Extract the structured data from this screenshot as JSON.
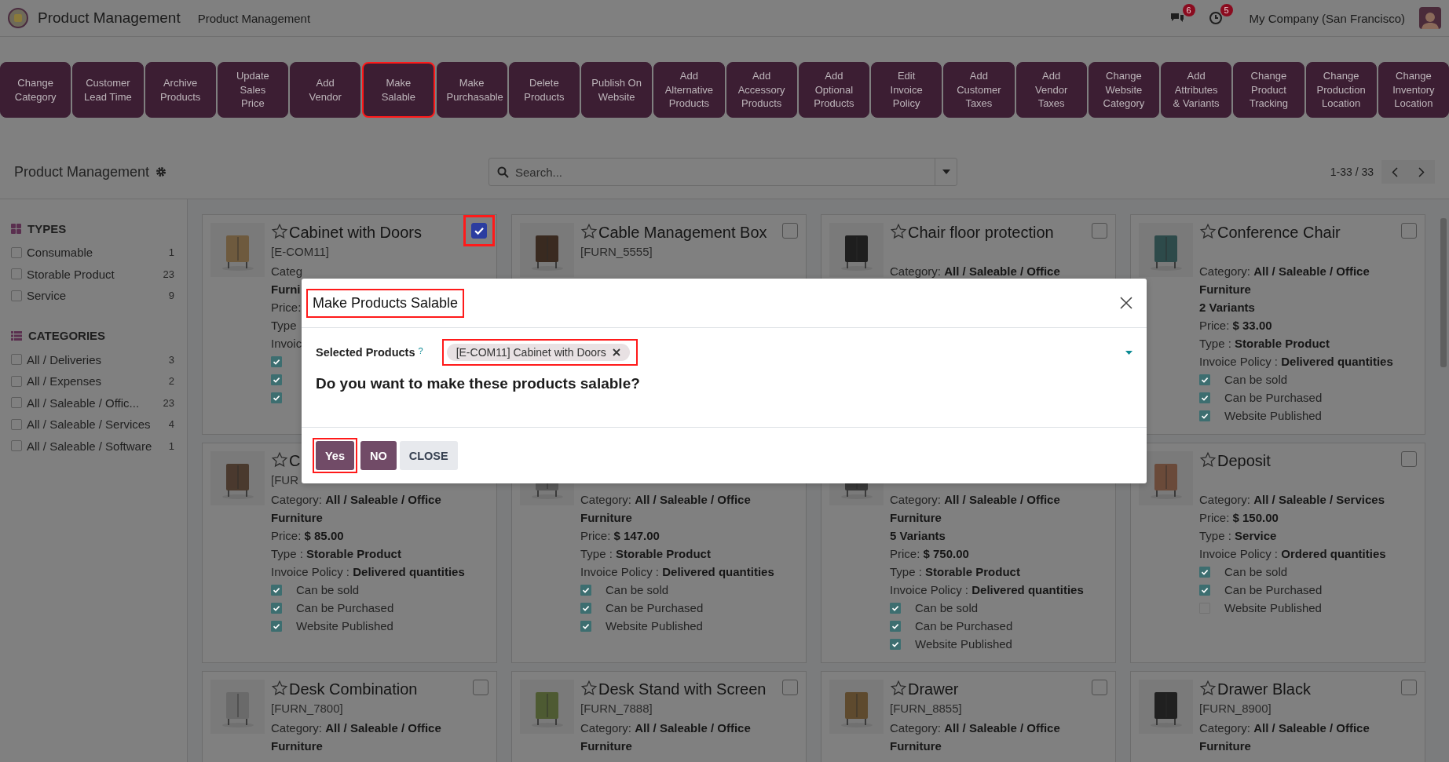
{
  "navbar": {
    "app_name": "Product Management",
    "menu_item": "Product Management",
    "messages_count": "6",
    "activities_count": "5",
    "company": "My Company (San Francisco)"
  },
  "action_buttons": [
    {
      "label": "Change Category",
      "highlighted": false
    },
    {
      "label": "Customer Lead Time",
      "highlighted": false
    },
    {
      "label": "Archive Products",
      "highlighted": false
    },
    {
      "label": "Update Sales Price",
      "highlighted": false
    },
    {
      "label": "Add Vendor",
      "highlighted": false
    },
    {
      "label": "Make Salable",
      "highlighted": true
    },
    {
      "label": "Make Purchasable",
      "highlighted": false
    },
    {
      "label": "Delete Products",
      "highlighted": false
    },
    {
      "label": "Publish On Website",
      "highlighted": false
    },
    {
      "label": "Add Alternative Products",
      "highlighted": false
    },
    {
      "label": "Add Accessory Products",
      "highlighted": false
    },
    {
      "label": "Add Optional Products",
      "highlighted": false
    },
    {
      "label": "Edit Invoice Policy",
      "highlighted": false
    },
    {
      "label": "Add Customer Taxes",
      "highlighted": false
    },
    {
      "label": "Add Vendor Taxes",
      "highlighted": false
    },
    {
      "label": "Change Website Category",
      "highlighted": false
    },
    {
      "label": "Add Attributes & Variants",
      "highlighted": false
    },
    {
      "label": "Change Product Tracking",
      "highlighted": false
    },
    {
      "label": "Change Production Location",
      "highlighted": false
    },
    {
      "label": "Change Inventory Location",
      "highlighted": false
    }
  ],
  "control_panel": {
    "title": "Product Management",
    "search_placeholder": "Search...",
    "pager": "1-33 / 33"
  },
  "sidebar": {
    "sections": [
      {
        "title": "TYPES",
        "kind": "grid",
        "items": [
          {
            "label": "Consumable",
            "count": "1",
            "checked": false
          },
          {
            "label": "Storable Product",
            "count": "23",
            "checked": false
          },
          {
            "label": "Service",
            "count": "9",
            "checked": false
          }
        ]
      },
      {
        "title": "CATEGORIES",
        "kind": "list",
        "items": [
          {
            "label": "All / Deliveries",
            "count": "3",
            "checked": false
          },
          {
            "label": "All / Expenses",
            "count": "2",
            "checked": false
          },
          {
            "label": "All / Saleable / Offic...",
            "count": "23",
            "checked": false
          },
          {
            "label": "All / Saleable / Services",
            "count": "4",
            "checked": false
          },
          {
            "label": "All / Saleable / Software",
            "count": "1",
            "checked": false
          }
        ]
      }
    ]
  },
  "cards": [
    {
      "title": "Cabinet with Doors",
      "code": "[E-COM11]",
      "selected": true,
      "highlighted": true,
      "lines": [
        {
          "label": "Categ"
        },
        {
          "value": "Furni"
        },
        {
          "label": "Price:"
        },
        {
          "label": "Type"
        },
        {
          "label": "Invoic"
        }
      ],
      "checks": [
        {
          "checked": true
        },
        {
          "checked": true
        },
        {
          "checked": true
        }
      ]
    },
    {
      "title": "Cable Management Box",
      "code": "[FURN_5555]",
      "selected": false,
      "highlighted": false
    },
    {
      "title": "Chair floor protection",
      "selected": false,
      "highlighted": false,
      "lines": [
        {
          "label": "Category:",
          "value": "All / Saleable / Office"
        }
      ]
    },
    {
      "title": "Conference Chair",
      "selected": false,
      "highlighted": false,
      "lines": [
        {
          "label": "Category:",
          "value": "All / Saleable / Office Furniture"
        },
        {
          "value": "2 Variants"
        },
        {
          "label": "Price:",
          "value": "$ 33.00"
        },
        {
          "label": "Type :",
          "value": "Storable Product"
        },
        {
          "label": "Invoice Policy :",
          "value": "Delivered quantities"
        }
      ],
      "checks": [
        {
          "label": "Can be sold",
          "checked": true
        },
        {
          "label": "Can be Purchased",
          "checked": true
        },
        {
          "label": "Website Published",
          "checked": true
        }
      ]
    },
    {
      "title": "C",
      "code": "[FUR",
      "lines": [
        {
          "label": "Category:",
          "value": "All / Saleable / Office Furniture"
        },
        {
          "label": "Price:",
          "value": "$ 85.00"
        },
        {
          "label": "Type :",
          "value": "Storable Product"
        },
        {
          "label": "Invoice Policy :",
          "value": "Delivered quantities"
        }
      ],
      "checks": [
        {
          "label": "Can be sold",
          "checked": true
        },
        {
          "label": "Can be Purchased",
          "checked": true
        },
        {
          "label": "Website Published",
          "checked": true
        }
      ]
    },
    {
      "lines": [
        {
          "label": "Category:",
          "value": "All / Saleable / Office Furniture"
        },
        {
          "label": "Price:",
          "value": "$ 147.00"
        },
        {
          "label": "Type :",
          "value": "Storable Product"
        },
        {
          "label": "Invoice Policy :",
          "value": "Delivered quantities"
        }
      ],
      "checks": [
        {
          "label": "Can be sold",
          "checked": true
        },
        {
          "label": "Can be Purchased",
          "checked": true
        },
        {
          "label": "Website Published",
          "checked": true
        }
      ]
    },
    {
      "lines": [
        {
          "label": "Category:",
          "value": "All / Saleable / Office Furniture"
        },
        {
          "value": "5 Variants"
        },
        {
          "label": "Price:",
          "value": "$ 750.00"
        },
        {
          "label": "Type :",
          "value": "Storable Product"
        },
        {
          "label": "Invoice Policy :",
          "value": "Delivered quantities"
        }
      ],
      "checks": [
        {
          "label": "Can be sold",
          "checked": true
        },
        {
          "label": "Can be Purchased",
          "checked": true
        },
        {
          "label": "Website Published",
          "checked": true
        }
      ]
    },
    {
      "title": "Deposit",
      "selected": false,
      "highlighted": false,
      "lines": [
        {
          "label": "Category:",
          "value": "All / Saleable / Services"
        },
        {
          "label": "Price:",
          "value": "$ 150.00"
        },
        {
          "label": "Type :",
          "value": "Service"
        },
        {
          "label": "Invoice Policy :",
          "value": "Ordered quantities"
        }
      ],
      "checks": [
        {
          "label": "Can be sold",
          "checked": true
        },
        {
          "label": "Can be Purchased",
          "checked": true
        },
        {
          "label": "Website Published",
          "checked": false
        }
      ]
    },
    {
      "title": "Desk Combination",
      "code": "[FURN_7800]",
      "selected": false,
      "highlighted": false,
      "lines": [
        {
          "label": "Category:",
          "value": "All / Saleable / Office Furniture"
        }
      ]
    },
    {
      "title": "Desk Stand with Screen",
      "code": "[FURN_7888]",
      "selected": false,
      "highlighted": false,
      "lines": [
        {
          "label": "Category:",
          "value": "All / Saleable / Office Furniture"
        }
      ]
    },
    {
      "title": "Drawer",
      "code": "[FURN_8855]",
      "selected": false,
      "highlighted": false,
      "lines": [
        {
          "label": "Category:",
          "value": "All / Saleable / Office Furniture"
        }
      ]
    },
    {
      "title": "Drawer Black",
      "code": "[FURN_8900]",
      "selected": false,
      "highlighted": false,
      "lines": [
        {
          "label": "Category:",
          "value": "All / Saleable / Office Furniture"
        }
      ]
    }
  ],
  "dialog": {
    "title": "Make Products Salable",
    "title_highlighted": true,
    "field_label": "Selected Products",
    "help_mark": "?",
    "tag": "[E-COM11] Cabinet with Doors",
    "tag_highlighted": true,
    "question": "Do you want to make these products salable?",
    "buttons": [
      {
        "label": "Yes",
        "kind": "primary",
        "highlighted": true
      },
      {
        "label": "NO",
        "kind": "primary",
        "highlighted": false
      },
      {
        "label": "CLOSE",
        "kind": "secondary",
        "highlighted": false
      }
    ]
  }
}
